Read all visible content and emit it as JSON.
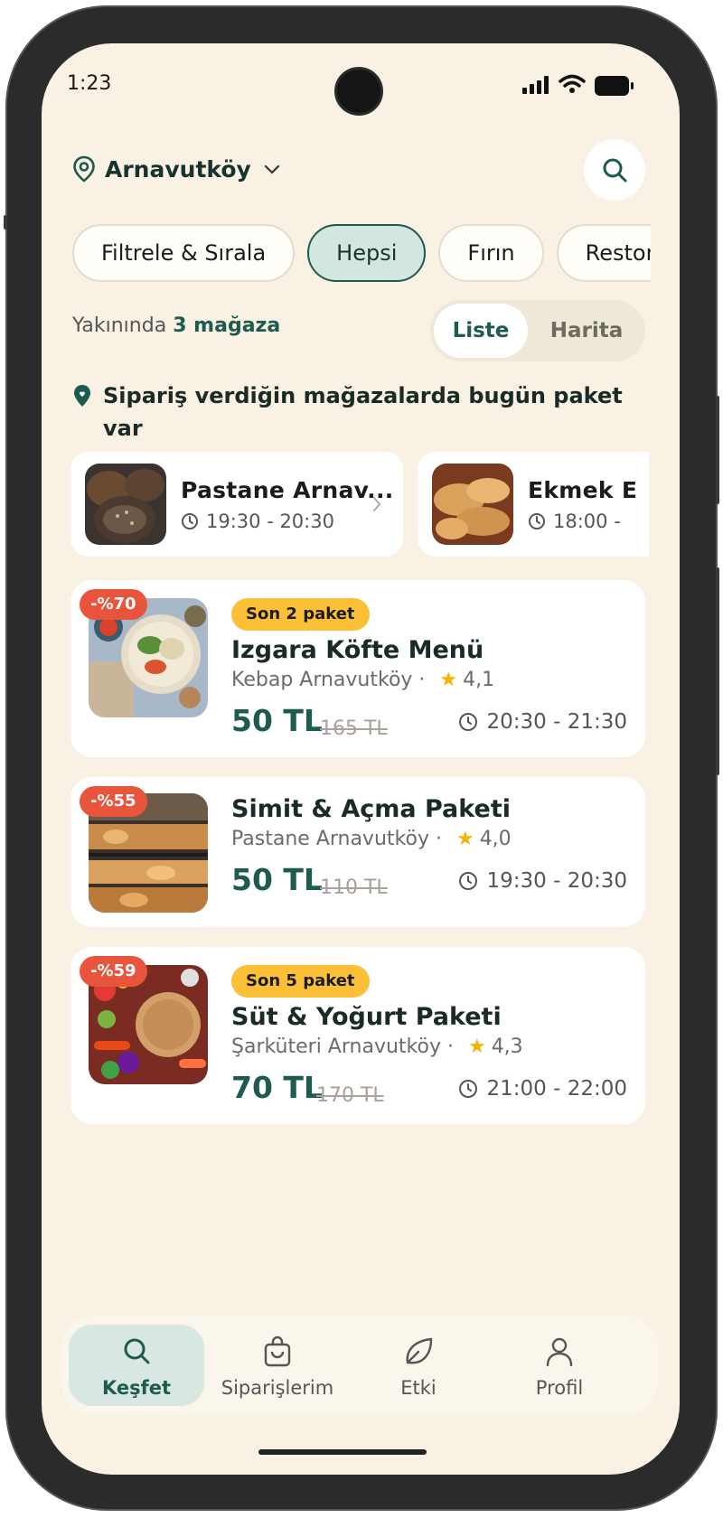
{
  "status_bar": {
    "time": "1:23"
  },
  "header": {
    "location": "Arnavutköy",
    "search_icon": "search-icon"
  },
  "filters": [
    "Filtrele & Sırala",
    "Hepsi",
    "Fırın",
    "Restoran"
  ],
  "nearby": {
    "prefix": "Yakınında",
    "count_text": "3 mağaza"
  },
  "view_toggle": {
    "list": "Liste",
    "map": "Harita",
    "selected": "Liste"
  },
  "notice": {
    "text": "Sipariş verdiğin mağazalarda bugün paket var"
  },
  "previous_stores": [
    {
      "name": "Pastane Arnav...",
      "time": "19:30 - 20:30"
    },
    {
      "name": "Ekmek E",
      "time": "18:00 -"
    }
  ],
  "offers": [
    {
      "discount": "-%70",
      "badge": "Son 2 paket",
      "title": "Izgara Köfte Menü",
      "store": "Kebap Arnavutköy ·",
      "rating": "4,1",
      "price": "50 TL",
      "old_price": "165 TL",
      "time": "20:30 - 21:30"
    },
    {
      "discount": "-%55",
      "badge": "",
      "title": "Simit & Açma Paketi",
      "store": "Pastane Arnavutköy ·",
      "rating": "4,0",
      "price": "50 TL",
      "old_price": "110 TL",
      "time": "19:30 - 20:30"
    },
    {
      "discount": "-%59",
      "badge": "Son 5 paket",
      "title": "Süt & Yoğurt Paketi",
      "store": "Şarküteri Arnavutköy ·",
      "rating": "4,3",
      "price": "70 TL",
      "old_price": "170 TL",
      "time": "21:00 - 22:00"
    }
  ],
  "bottom_nav": [
    {
      "label": "Keşfet",
      "icon": "search-icon",
      "active": true
    },
    {
      "label": "Siparişlerim",
      "icon": "bag-icon",
      "active": false
    },
    {
      "label": "Etki",
      "icon": "leaf-icon",
      "active": false
    },
    {
      "label": "Profil",
      "icon": "person-icon",
      "active": false
    }
  ],
  "colors": {
    "background": "#f8f1e4",
    "brand": "#1d5b50",
    "discount": "#e9553c",
    "badge": "#fbbf38"
  }
}
